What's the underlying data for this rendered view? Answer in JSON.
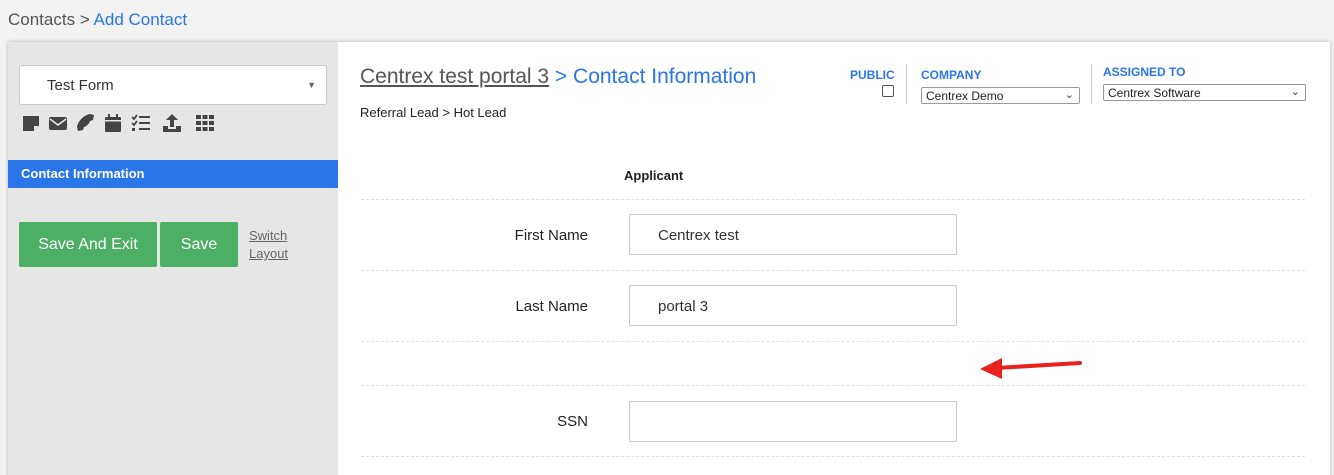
{
  "breadcrumb": {
    "root": "Contacts",
    "separator": " > ",
    "current": "Add Contact"
  },
  "sidebar": {
    "form_select": {
      "value": "Test Form"
    },
    "toolbar_icons": [
      "note-icon",
      "mail-icon",
      "phone-icon",
      "calendar-icon",
      "checklist-icon",
      "upload-icon",
      "grid-icon"
    ],
    "nav_item": "Contact Information",
    "save_exit_label": "Save And Exit",
    "save_label": "Save",
    "switch_layout_label": "Switch Layout"
  },
  "header": {
    "title_portal": "Centrex test portal 3",
    "title_section": " > Contact Information",
    "subcrumb": "Referral Lead > Hot Lead",
    "public_label": "PUBLIC",
    "company_label": "COMPANY",
    "company_value": "Centrex Demo",
    "assigned_label": "ASSIGNED TO",
    "assigned_value": "Centrex Software"
  },
  "form": {
    "section_label": "Applicant",
    "fields": [
      {
        "label": "First Name",
        "value": "Centrex test"
      },
      {
        "label": "Last Name",
        "value": "portal 3"
      },
      {
        "label": "SSN",
        "value": ""
      }
    ]
  },
  "colors": {
    "accent": "#2a76e8",
    "button": "#4caf63",
    "annotation_arrow": "#e8231f"
  }
}
